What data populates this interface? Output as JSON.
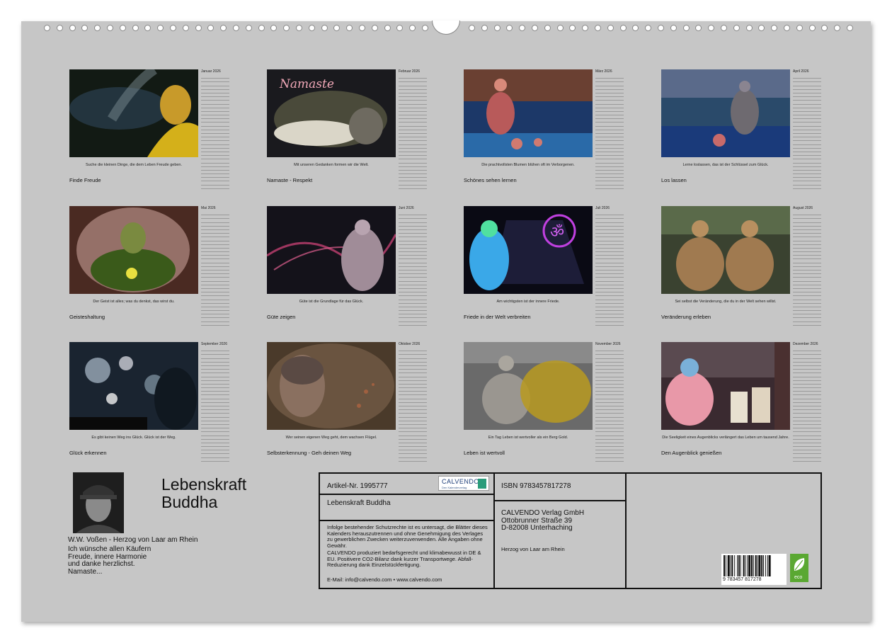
{
  "months": [
    {
      "name": "Januar 2026",
      "title": "Finde Freude",
      "caption": "Suche die kleinen Dinge, die dem Leben Freude geben."
    },
    {
      "name": "Februar 2026",
      "title": "Namaste - Respekt",
      "caption": "Mit unseren Gedanken formen wir die Welt.",
      "image_text": "Namaste"
    },
    {
      "name": "März 2026",
      "title": "Schönes sehen lernen",
      "caption": "Die prachtvollsten Blumen blühen oft im Verborgenen."
    },
    {
      "name": "April 2026",
      "title": "Los lassen",
      "caption": "Lerne loslassen, das ist der Schlüssel zum Glück."
    },
    {
      "name": "Mai 2026",
      "title": "Geisteshaltung",
      "caption": "Der Geist ist alles; was du denkst, das wirst du."
    },
    {
      "name": "Juni 2026",
      "title": "Güte zeigen",
      "caption": "Güte ist die Grundlage für das Glück."
    },
    {
      "name": "Juli 2026",
      "title": "Friede in der Welt verbreiten",
      "caption": "Am wichtigsten ist der innere Friede."
    },
    {
      "name": "August 2026",
      "title": "Veränderung erleben",
      "caption": "Sei selbst die Veränderung, die du in der Welt sehen willst."
    },
    {
      "name": "September 2026",
      "title": "Glück erkennen",
      "caption": "Es gibt keinen Weg ins Glück. Glück ist der Weg."
    },
    {
      "name": "Oktober 2026",
      "title": "Selbsterkennung - Geh deinen Weg",
      "caption": "Wer seinen eigenen Weg geht, dem wachsen Flügel."
    },
    {
      "name": "November 2026",
      "title": "Leben ist wertvoll",
      "caption": "Ein Tag Leben ist wertvoller als ein Berg Gold."
    },
    {
      "name": "Dezember 2026",
      "title": "Den Augenblick genießen",
      "caption": "Die Seeligkeit eines Augenblicks verlängert das Leben um tausend Jahre."
    }
  ],
  "cover": {
    "title_line1": "Lebenskraft",
    "title_line2": "Buddha",
    "author": "W.W. Voßen - Herzog von Laar am Rhein",
    "message_lines": [
      "Ich wünsche allen Käufern",
      "Freude, innere Harmonie",
      "und danke herzlichst.",
      "Namaste..."
    ]
  },
  "infobox": {
    "article": "Artikel-Nr. 1995777",
    "logo_text": "CALVENDO",
    "logo_sub": "Den Kalenderverlag",
    "product_title": "Lebenskraft Buddha",
    "legal": "Infolge bestehender Schutzrechte ist es untersagt, die Blätter dieses Kalenders herauszutrennen und ohne Genehmigung des Verlages zu gewerblichen Zwecken weiterzuverwenden. Alle Angaben ohne Gewähr.",
    "eco_text": "CALVENDO produziert bedarfsgerecht und klimabewusst in DE & EU. Positivere CO2-Bilanz dank kurzer Transportwege. Abfall-Reduzierung dank Einzelstückfertigung.",
    "contact": "E-Mail: info@calvendo.com • www.calvendo.com",
    "isbn": "ISBN 9783457817278",
    "publisher_lines": [
      "CALVENDO Verlag GmbH",
      "Ottobrunner Straße 39",
      "D-82008 Unterhaching"
    ],
    "author_short": "Herzog von Laar am Rhein",
    "barcode_number": "9 783457 817278",
    "eco_label": "eco"
  },
  "colors": {
    "sheet": "#c6c6c6",
    "eco_green": "#5aa832"
  }
}
